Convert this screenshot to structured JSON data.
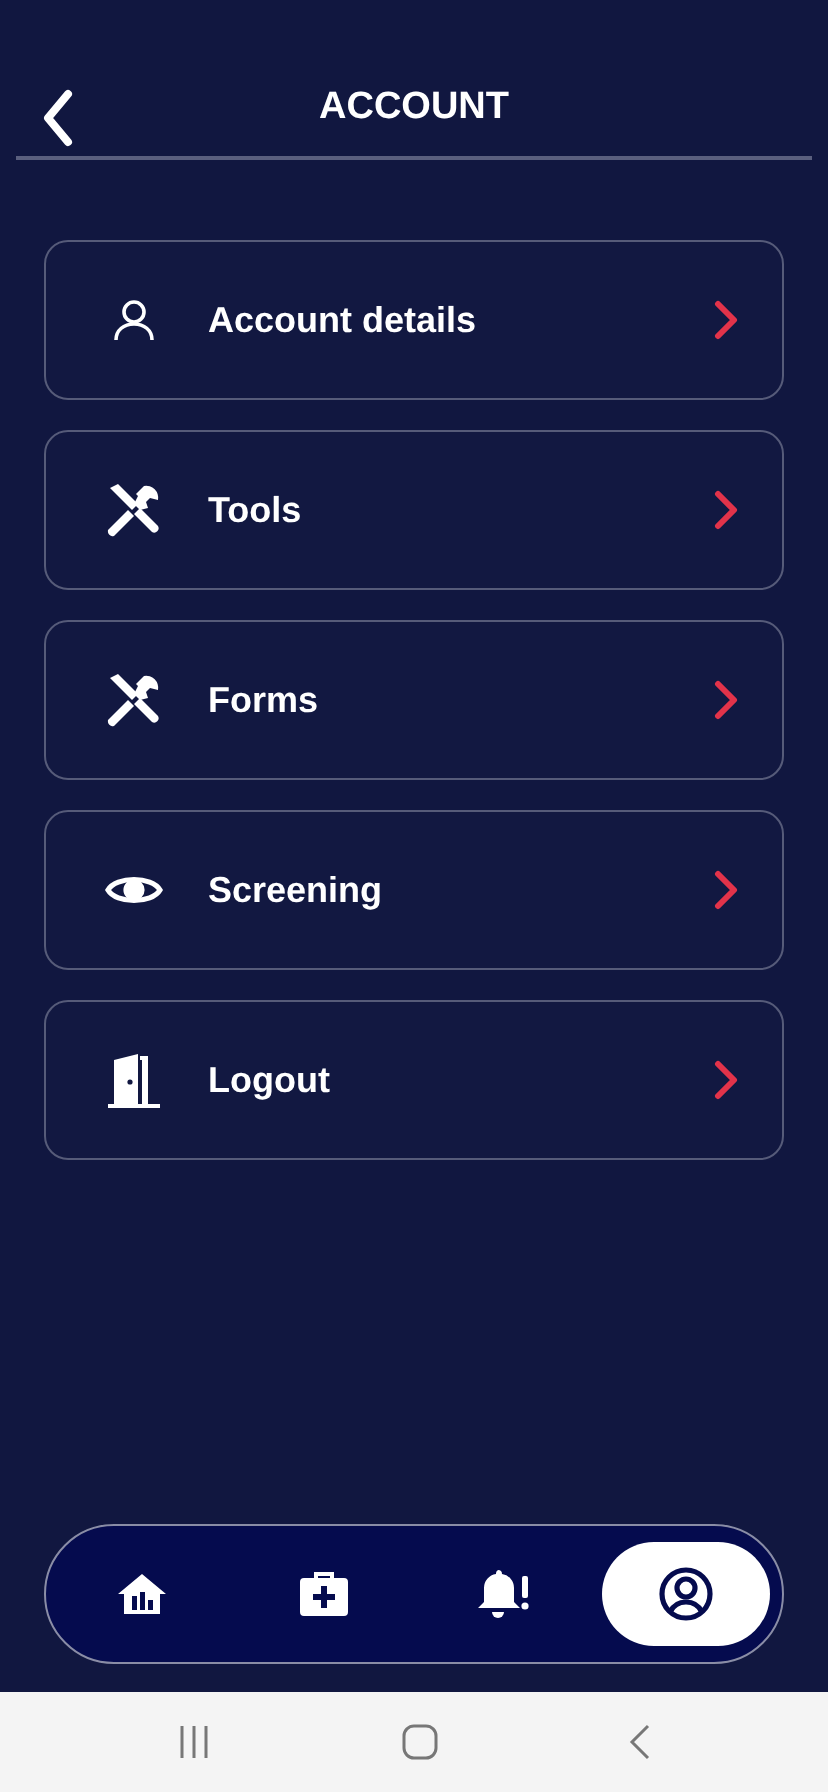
{
  "header": {
    "title": "ACCOUNT"
  },
  "menu": [
    {
      "kind": "person",
      "label": "Account details"
    },
    {
      "kind": "tools",
      "label": "Tools"
    },
    {
      "kind": "tools",
      "label": "Forms"
    },
    {
      "kind": "eye",
      "label": "Screening"
    },
    {
      "kind": "door",
      "label": "Logout"
    }
  ],
  "tab_bar": [
    {
      "kind": "home",
      "selected": false
    },
    {
      "kind": "medkit",
      "selected": false
    },
    {
      "kind": "bell",
      "selected": false
    },
    {
      "kind": "profile",
      "selected": true
    }
  ]
}
